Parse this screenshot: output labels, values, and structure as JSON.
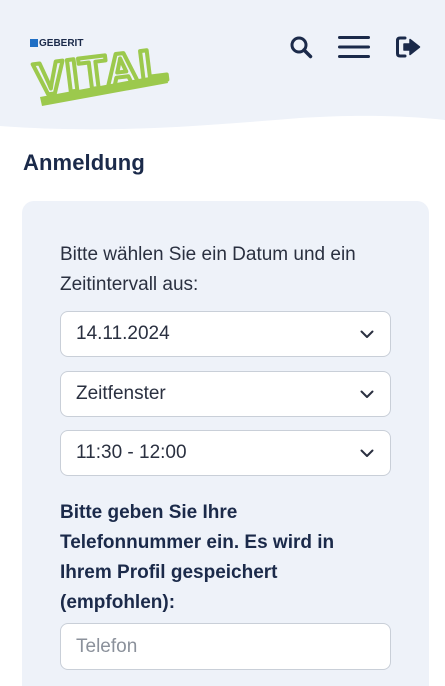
{
  "brand": {
    "maker": "GEBERIT",
    "product": "VITAL",
    "accent_green": "#9cc94d",
    "accent_blue": "#1f6fc5"
  },
  "header": {
    "icons": [
      "search-icon",
      "menu-icon",
      "logout-icon"
    ]
  },
  "page": {
    "title": "Anmeldung"
  },
  "form": {
    "intro": "Bitte wählen Sie ein Datum und ein Zeitintervall aus:",
    "date_value": "14.11.2024",
    "window_value": "Zeitfenster",
    "time_value": "11:30 - 12:00",
    "phone_prompt": "Bitte geben Sie Ihre Telefonnummer ein. Es wird in Ihrem Profil gespeichert (empfohlen):",
    "phone_placeholder": "Telefon"
  },
  "colors": {
    "navy": "#1b2a4a",
    "panel": "#eef2f9"
  }
}
